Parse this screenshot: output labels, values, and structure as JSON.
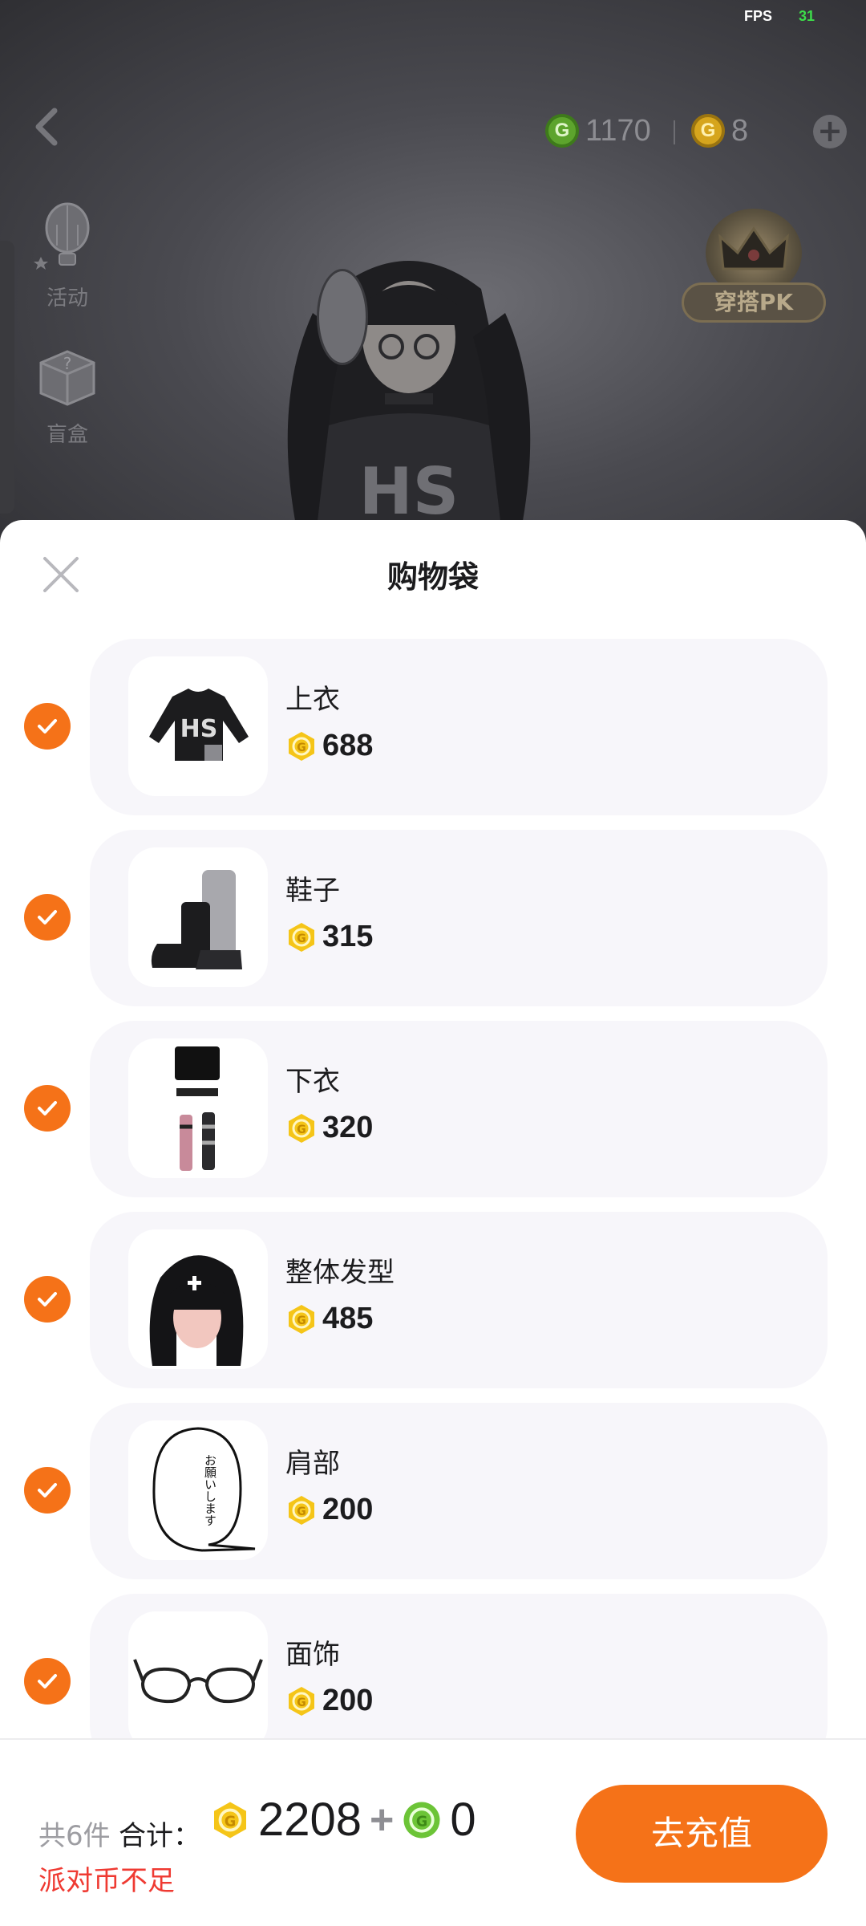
{
  "status": {
    "fps_label": "FPS",
    "fps_value": "31"
  },
  "topbar": {
    "green_coin": "1170",
    "gold_coin": "8"
  },
  "sidebar": {
    "items": [
      {
        "label": "活动",
        "icon": "hot-air-balloon-icon"
      },
      {
        "label": "盲盒",
        "icon": "mystery-box-icon"
      }
    ]
  },
  "pk_badge": {
    "label": "穿搭PK"
  },
  "speech_bubble": {
    "text": "お願いします"
  },
  "sheet": {
    "title": "购物袋",
    "items": [
      {
        "name": "上衣",
        "price": "688"
      },
      {
        "name": "鞋子",
        "price": "315"
      },
      {
        "name": "下衣",
        "price": "320"
      },
      {
        "name": "整体发型",
        "price": "485"
      },
      {
        "name": "肩部",
        "price": "200"
      },
      {
        "name": "面饰",
        "price": "200"
      }
    ]
  },
  "footer": {
    "count": "共6件",
    "total_label": "合计：",
    "gold_total": "2208",
    "plus": "+",
    "green_total": "0",
    "warning": "派对币不足",
    "button": "去充值"
  },
  "colors": {
    "accent": "#f57218",
    "warning": "#ef3a32",
    "gold": "#f5c518",
    "green": "#5da42d"
  }
}
